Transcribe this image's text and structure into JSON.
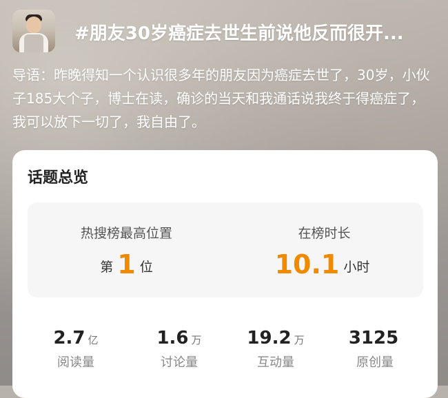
{
  "post": {
    "title": "#朋友30岁癌症去世生前说他反而很开...",
    "intro": "导语：昨晚得知一个认识很多年的朋友因为癌症去世了，30岁，小伙子185大个子，博士在读，确诊的当天和我通话说我终于得癌症了，我可以放下一切了，我自由了。"
  },
  "overview": {
    "title": "话题总览",
    "peak": {
      "label": "热搜榜最高位置",
      "prefix": "第",
      "value": "1",
      "suffix": "位"
    },
    "duration": {
      "label": "在榜时长",
      "value": "10.1",
      "unit": "小时"
    },
    "metrics": [
      {
        "value": "2.7",
        "unit": "亿",
        "label": "阅读量"
      },
      {
        "value": "1.6",
        "unit": "万",
        "label": "讨论量"
      },
      {
        "value": "19.2",
        "unit": "万",
        "label": "互动量"
      },
      {
        "value": "3125",
        "unit": "",
        "label": "原创量"
      }
    ]
  },
  "colors": {
    "accent": "#f08a00",
    "card_bg": "#ffffff",
    "stats_bg": "#f6f6f6"
  }
}
